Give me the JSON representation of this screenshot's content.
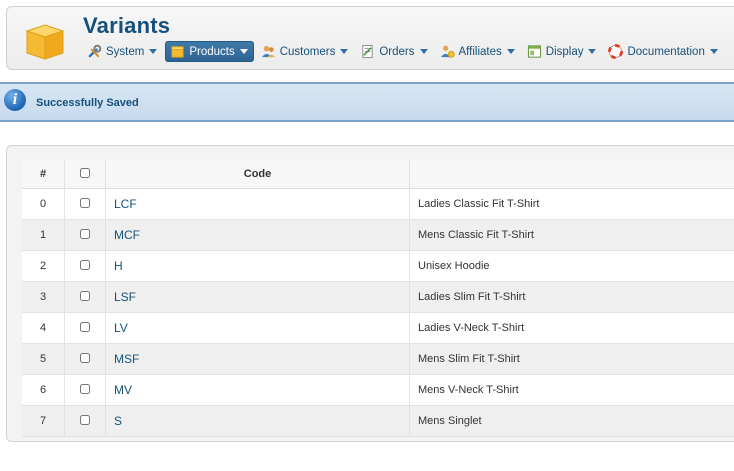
{
  "header": {
    "title": "Variants",
    "app_icon": "box-icon"
  },
  "menu": [
    {
      "label": "System",
      "icon": "wrench-icon",
      "active": false
    },
    {
      "label": "Products",
      "icon": "box-icon",
      "active": true
    },
    {
      "label": "Customers",
      "icon": "people-icon",
      "active": false
    },
    {
      "label": "Orders",
      "icon": "document-icon",
      "active": false
    },
    {
      "label": "Affiliates",
      "icon": "affiliate-icon",
      "active": false
    },
    {
      "label": "Display",
      "icon": "display-icon",
      "active": false
    },
    {
      "label": "Documentation",
      "icon": "lifebuoy-icon",
      "active": false
    }
  ],
  "message": {
    "text": "Successfully Saved",
    "icon": "info-icon"
  },
  "table": {
    "headers": {
      "num": "#",
      "code": "Code",
      "description": ""
    },
    "rows": [
      {
        "num": "0",
        "code": "LCF",
        "description": "Ladies Classic Fit T-Shirt"
      },
      {
        "num": "1",
        "code": "MCF",
        "description": "Mens Classic Fit T-Shirt"
      },
      {
        "num": "2",
        "code": "H",
        "description": "Unisex Hoodie"
      },
      {
        "num": "3",
        "code": "LSF",
        "description": "Ladies Slim Fit T-Shirt"
      },
      {
        "num": "4",
        "code": "LV",
        "description": "Ladies V-Neck T-Shirt"
      },
      {
        "num": "5",
        "code": "MSF",
        "description": "Mens Slim Fit T-Shirt"
      },
      {
        "num": "6",
        "code": "MV",
        "description": "Mens V-Neck T-Shirt"
      },
      {
        "num": "7",
        "code": "S",
        "description": "Mens Singlet"
      }
    ]
  },
  "colors": {
    "accent": "#15517a",
    "active_menu": "#2d6392",
    "message_bg": "#c7daee"
  }
}
